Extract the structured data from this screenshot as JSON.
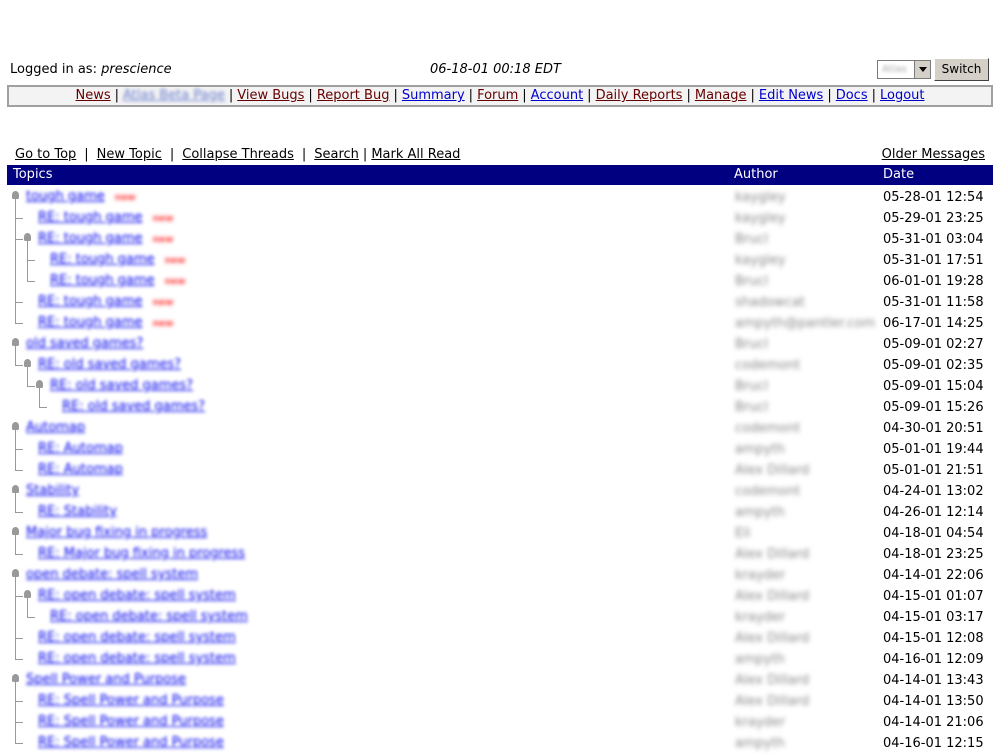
{
  "header": {
    "logged_in_label": "Logged in as:",
    "username": "prescience",
    "datetime": "06-18-01 00:18 EDT",
    "project_select_value": "Atlas",
    "switch_label": "Switch"
  },
  "nav": {
    "items": [
      {
        "label": "News",
        "style": "visited"
      },
      {
        "label": "Atlas Beta Page",
        "style": "blurred"
      },
      {
        "label": "View Bugs",
        "style": "visited"
      },
      {
        "label": "Report Bug",
        "style": "visited"
      },
      {
        "label": "Summary",
        "style": "link"
      },
      {
        "label": "Forum",
        "style": "visited"
      },
      {
        "label": "Account",
        "style": "link"
      },
      {
        "label": "Daily Reports",
        "style": "visited"
      },
      {
        "label": "Manage",
        "style": "visited"
      },
      {
        "label": "Edit News",
        "style": "link"
      },
      {
        "label": "Docs",
        "style": "link"
      },
      {
        "label": "Logout",
        "style": "link"
      }
    ]
  },
  "actions": {
    "go_to_top": "Go to Top",
    "new_topic": "New Topic",
    "collapse_threads": "Collapse Threads",
    "search": "Search",
    "mark_all_read": "Mark All Read",
    "older_messages": "Older Messages"
  },
  "table": {
    "headers": {
      "topics": "Topics",
      "author": "Author",
      "date": "Date"
    },
    "new_badge": "new",
    "rows": [
      {
        "depth": 0,
        "title": "tough game",
        "new": true,
        "author": "kaygley",
        "date": "05-28-01 12:54"
      },
      {
        "depth": 1,
        "title": "RE: tough game",
        "new": true,
        "author": "kaygley",
        "date": "05-29-01 23:25"
      },
      {
        "depth": 1,
        "title": "RE: tough game",
        "new": true,
        "author": "Brucl",
        "date": "05-31-01 03:04"
      },
      {
        "depth": 2,
        "title": "RE: tough game",
        "new": true,
        "author": "kaygley",
        "date": "05-31-01 17:51"
      },
      {
        "depth": 2,
        "title": "RE: tough game",
        "new": true,
        "author": "Brucl",
        "date": "06-01-01 19:28"
      },
      {
        "depth": 1,
        "title": "RE: tough game",
        "new": true,
        "author": "shadowcat",
        "date": "05-31-01 11:58"
      },
      {
        "depth": 1,
        "title": "RE: tough game",
        "new": true,
        "author": "ampyth@pantler.com",
        "date": "06-17-01 14:25"
      },
      {
        "depth": 0,
        "title": "old saved games?",
        "new": false,
        "author": "Brucl",
        "date": "05-09-01 02:27"
      },
      {
        "depth": 1,
        "title": "RE: old saved games?",
        "new": false,
        "author": "codemont",
        "date": "05-09-01 02:35"
      },
      {
        "depth": 2,
        "title": "RE: old saved games?",
        "new": false,
        "author": "Brucl",
        "date": "05-09-01 15:04"
      },
      {
        "depth": 3,
        "title": "RE: old saved games?",
        "new": false,
        "author": "Brucl",
        "date": "05-09-01 15:26"
      },
      {
        "depth": 0,
        "title": "Automap",
        "new": false,
        "author": "codemont",
        "date": "04-30-01 20:51"
      },
      {
        "depth": 1,
        "title": "RE: Automap",
        "new": false,
        "author": "ampyth",
        "date": "05-01-01 19:44"
      },
      {
        "depth": 1,
        "title": "RE: Automap",
        "new": false,
        "author": "Alex Dillard",
        "date": "05-01-01 21:51"
      },
      {
        "depth": 0,
        "title": "Stability",
        "new": false,
        "author": "codemont",
        "date": "04-24-01 13:02"
      },
      {
        "depth": 1,
        "title": "RE: Stability",
        "new": false,
        "author": "ampyth",
        "date": "04-26-01 12:14"
      },
      {
        "depth": 0,
        "title": "Major bug fixing in progress",
        "new": false,
        "author": "Eli",
        "date": "04-18-01 04:54"
      },
      {
        "depth": 1,
        "title": "RE: Major bug fixing in progress",
        "new": false,
        "author": "Alex Dillard",
        "date": "04-18-01 23:25"
      },
      {
        "depth": 0,
        "title": "open debate: spell system",
        "new": false,
        "author": "krayder",
        "date": "04-14-01 22:06"
      },
      {
        "depth": 1,
        "title": "RE: open debate: spell system",
        "new": false,
        "author": "Alex Dillard",
        "date": "04-15-01 01:07"
      },
      {
        "depth": 2,
        "title": "RE: open debate: spell system",
        "new": false,
        "author": "krayder",
        "date": "04-15-01 03:17"
      },
      {
        "depth": 1,
        "title": "RE: open debate: spell system",
        "new": false,
        "author": "Alex Dillard",
        "date": "04-15-01 12:08"
      },
      {
        "depth": 1,
        "title": "RE: open debate: spell system",
        "new": false,
        "author": "ampyth",
        "date": "04-16-01 12:09"
      },
      {
        "depth": 0,
        "title": "Spell Power and Purpose",
        "new": false,
        "author": "Alex Dillard",
        "date": "04-14-01 13:43"
      },
      {
        "depth": 1,
        "title": "RE: Spell Power and Purpose",
        "new": false,
        "author": "Alex Dillard",
        "date": "04-14-01 13:50"
      },
      {
        "depth": 1,
        "title": "RE: Spell Power and Purpose",
        "new": false,
        "author": "krayder",
        "date": "04-14-01 21:06"
      },
      {
        "depth": 1,
        "title": "RE: Spell Power and Purpose",
        "new": false,
        "author": "ampyth",
        "date": "04-16-01 12:15"
      }
    ]
  },
  "colors": {
    "header_bg": "#000080",
    "link": "#0000ee",
    "visited": "#660000",
    "new_badge": "#ff3333"
  }
}
